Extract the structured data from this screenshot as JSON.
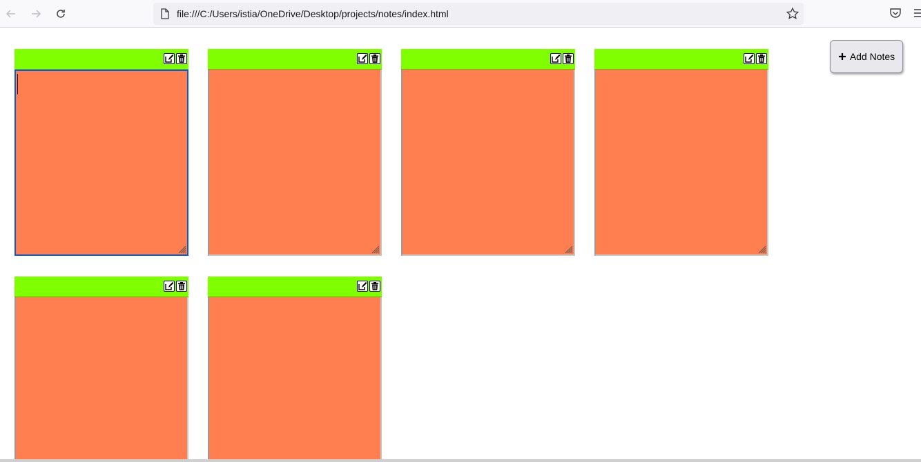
{
  "browser": {
    "url": "file:///C:/Users/istia/OneDrive/Desktop/projects/notes/index.html"
  },
  "app": {
    "add_button_label": "Add Notes",
    "add_button_icon": "plus-icon",
    "note_count": 6,
    "colors": {
      "note_header": "#80ff00",
      "note_body": "#ff7f50",
      "focus_border": "#0a5ad4"
    },
    "notes": [
      {
        "text": "",
        "focused": true
      },
      {
        "text": "",
        "focused": false
      },
      {
        "text": "",
        "focused": false
      },
      {
        "text": "",
        "focused": false
      },
      {
        "text": "",
        "focused": false
      },
      {
        "text": "",
        "focused": false
      }
    ]
  }
}
